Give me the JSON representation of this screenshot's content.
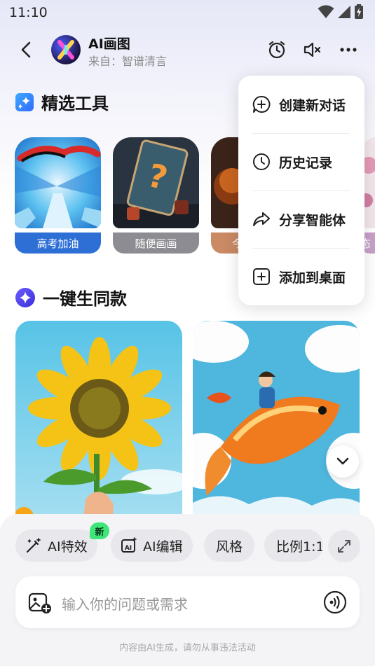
{
  "status_bar": {
    "time": "11:10"
  },
  "header": {
    "title": "AI画图",
    "subtitle": "来自：智谱清言",
    "icons": [
      "back-arrow-icon",
      "alarm-icon",
      "speaker-mute-icon",
      "more-dots-icon"
    ]
  },
  "sections": {
    "tools_title": "精选工具",
    "same_style_title": "一键生同款"
  },
  "tools": [
    {
      "label": "高考加油",
      "color": "#2e6fd6"
    },
    {
      "label": "随便画画",
      "color": "#8c8c92"
    },
    {
      "label": "今",
      "color": "#c98a64"
    },
    {
      "label": "态",
      "color": "#c8a0c8"
    }
  ],
  "menu": {
    "items": [
      {
        "label": "创建新对话",
        "icon": "chat-plus-icon"
      },
      {
        "label": "历史记录",
        "icon": "clock-icon"
      },
      {
        "label": "分享智能体",
        "icon": "share-icon"
      },
      {
        "label": "添加到桌面",
        "icon": "add-square-icon"
      }
    ]
  },
  "bottom": {
    "chips": [
      {
        "label": "AI特效",
        "icon": "magic-wand-icon"
      },
      {
        "label": "AI编辑",
        "icon": "ai-image-edit-icon"
      },
      {
        "label": "风格"
      },
      {
        "label": "比例1:1"
      }
    ],
    "new_badge": "新",
    "input_placeholder": "输入你的问题或需求",
    "disclaimer": "内容由AI生成，请勿从事违法活动"
  },
  "colors": {
    "accent_blue": "#2e6fd6",
    "badge_green": "#3ee67a"
  }
}
